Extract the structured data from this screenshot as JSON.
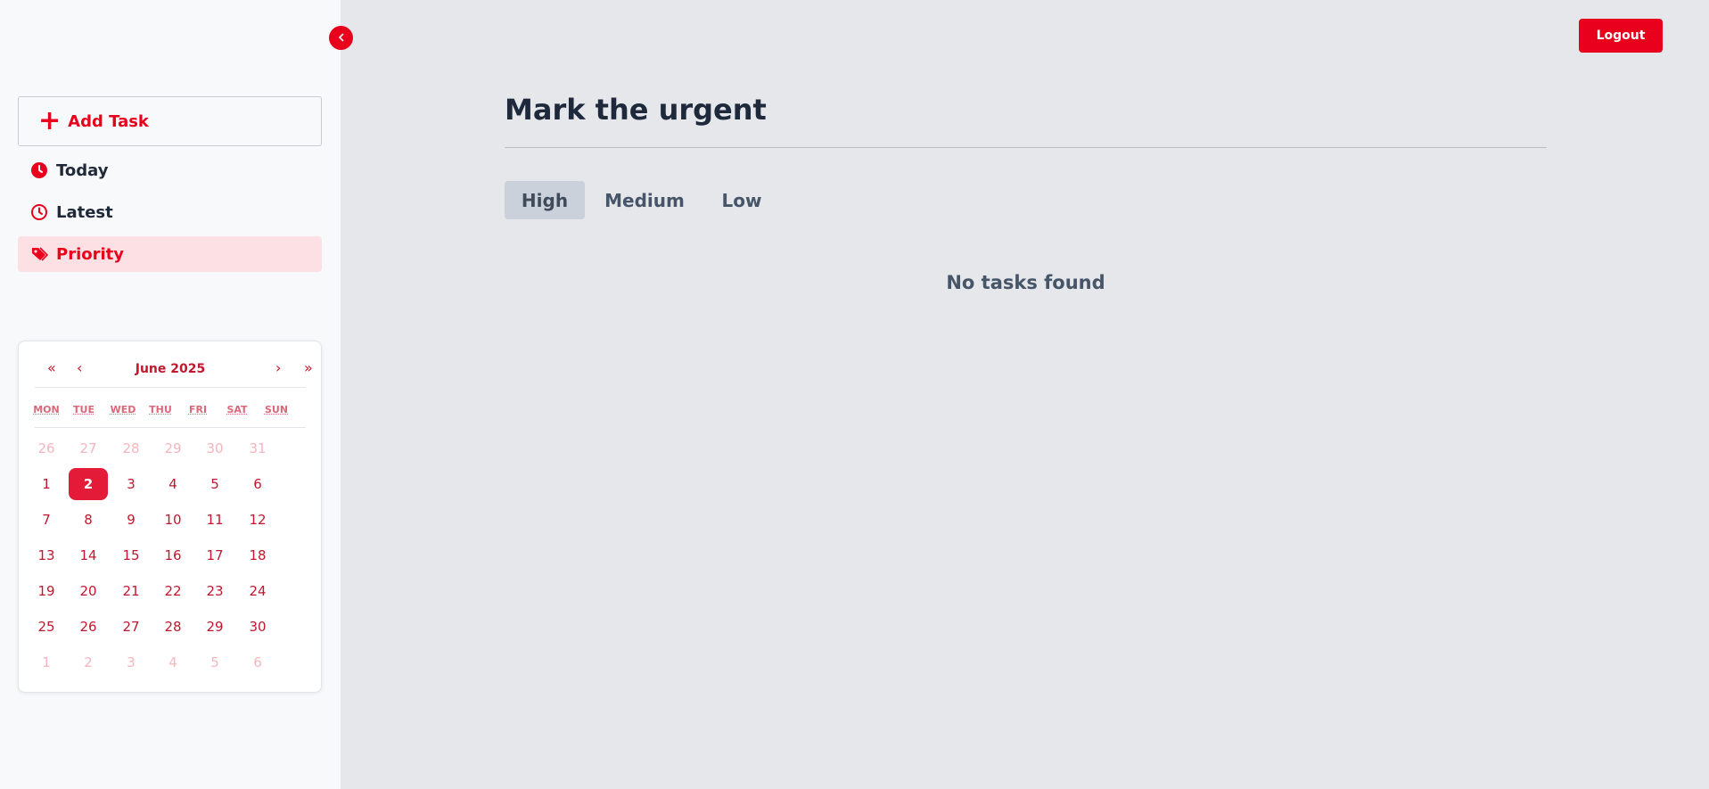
{
  "sidebar": {
    "collapse_icon": "chevron-left-icon",
    "add_task_label": "Add Task",
    "nav": [
      {
        "label": "Today",
        "icon": "clock-filled-icon",
        "active": false
      },
      {
        "label": "Latest",
        "icon": "clock-outline-icon",
        "active": false
      },
      {
        "label": "Priority",
        "icon": "tags-icon",
        "active": true
      }
    ]
  },
  "calendar": {
    "month_label": "June 2025",
    "prev_year": "«",
    "prev_month": "‹",
    "next_month": "›",
    "next_year": "»",
    "weekdays": [
      "MON",
      "TUE",
      "WED",
      "THU",
      "FRI",
      "SAT",
      "SUN"
    ],
    "weeks": [
      [
        "26",
        "27",
        "28",
        "29",
        "30",
        "31"
      ],
      [
        "1",
        "2",
        "3",
        "4",
        "5",
        "6"
      ],
      [
        "7",
        "8",
        "9",
        "10",
        "11",
        "12"
      ],
      [
        "13",
        "14",
        "15",
        "16",
        "17",
        "18"
      ],
      [
        "19",
        "20",
        "21",
        "22",
        "23",
        "24"
      ],
      [
        "25",
        "26",
        "27",
        "28",
        "29",
        "30"
      ],
      [
        "1",
        "2",
        "3",
        "4",
        "5",
        "6"
      ]
    ],
    "muted_weeks": [
      0,
      6
    ],
    "selected_day": "2"
  },
  "header": {
    "logout_label": "Logout"
  },
  "main": {
    "title": "Mark the urgent",
    "tabs": [
      {
        "label": "High",
        "active": true
      },
      {
        "label": "Medium",
        "active": false
      },
      {
        "label": "Low",
        "active": false
      }
    ],
    "empty_message": "No tasks found"
  },
  "colors": {
    "accent": "#e8001c",
    "active_bg": "#fde0e3",
    "calendar_text": "#c0182e",
    "calendar_muted": "#f4b5bd",
    "main_bg": "#e5e7eb",
    "sidebar_bg": "#f8f9fb"
  }
}
